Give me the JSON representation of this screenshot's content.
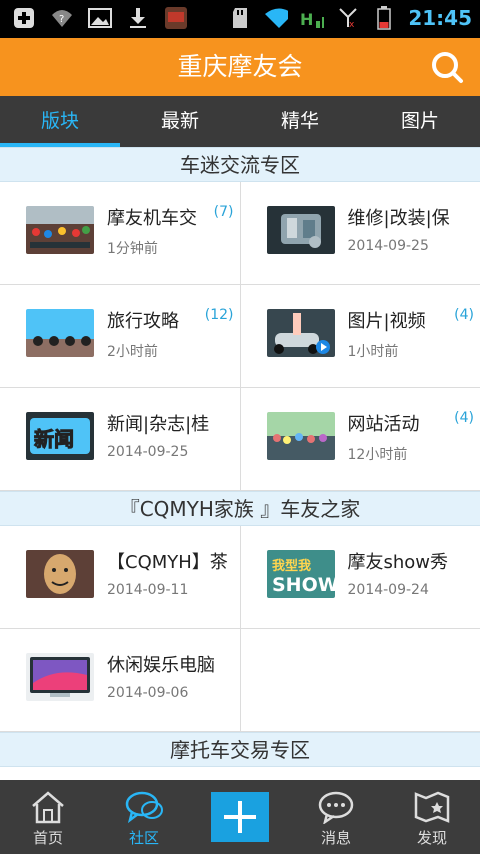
{
  "status_bar": {
    "time": "21:45",
    "icons": [
      "add-icon",
      "wifi-question-icon",
      "image-icon",
      "download-icon",
      "app-icon",
      "sd-card-icon",
      "wifi-icon",
      "signal-icon",
      "battery-icon"
    ]
  },
  "header": {
    "title": "重庆摩友会"
  },
  "tabs": [
    {
      "label": "版块",
      "active": true
    },
    {
      "label": "最新",
      "active": false
    },
    {
      "label": "精华",
      "active": false
    },
    {
      "label": "图片",
      "active": false
    }
  ],
  "sections": [
    {
      "title": "车迷交流专区",
      "items": [
        {
          "title": "摩友机车交",
          "count": "(7)",
          "meta": "1分钟前"
        },
        {
          "title": "维修|改装|保",
          "count": "",
          "meta": "2014-09-25"
        },
        {
          "title": "旅行攻略",
          "count": "(12)",
          "meta": "2小时前"
        },
        {
          "title": "图片|视频",
          "count": "(4)",
          "meta": "1小时前"
        },
        {
          "title": "新闻|杂志|桂",
          "count": "",
          "meta": "2014-09-25"
        },
        {
          "title": "网站活动",
          "count": "(4)",
          "meta": "12小时前"
        }
      ]
    },
    {
      "title": "『CQMYH家族 』车友之家",
      "items": [
        {
          "title": "【CQMYH】茶",
          "count": "",
          "meta": "2014-09-11"
        },
        {
          "title": "摩友show秀",
          "count": "",
          "meta": "2014-09-24"
        },
        {
          "title": "休闲娱乐电脑",
          "count": "",
          "meta": "2014-09-06"
        }
      ]
    },
    {
      "title": "摩托车交易专区",
      "items": []
    }
  ],
  "thumb_text": {
    "news": "新闻",
    "show_top": "我型我",
    "show_bottom": "SHOW"
  },
  "bottom_nav": [
    {
      "label": "首页",
      "icon": "home-icon",
      "active": false
    },
    {
      "label": "社区",
      "icon": "chat-bubbles-icon",
      "active": true
    },
    {
      "label": "",
      "icon": "plus-icon",
      "active": false
    },
    {
      "label": "消息",
      "icon": "message-icon",
      "active": false
    },
    {
      "label": "发现",
      "icon": "map-icon",
      "active": false
    }
  ],
  "colors": {
    "accent_orange": "#f7931e",
    "accent_blue": "#29b6f6",
    "tab_bg": "#3a3a3a",
    "section_bg": "#e3f2fb"
  }
}
